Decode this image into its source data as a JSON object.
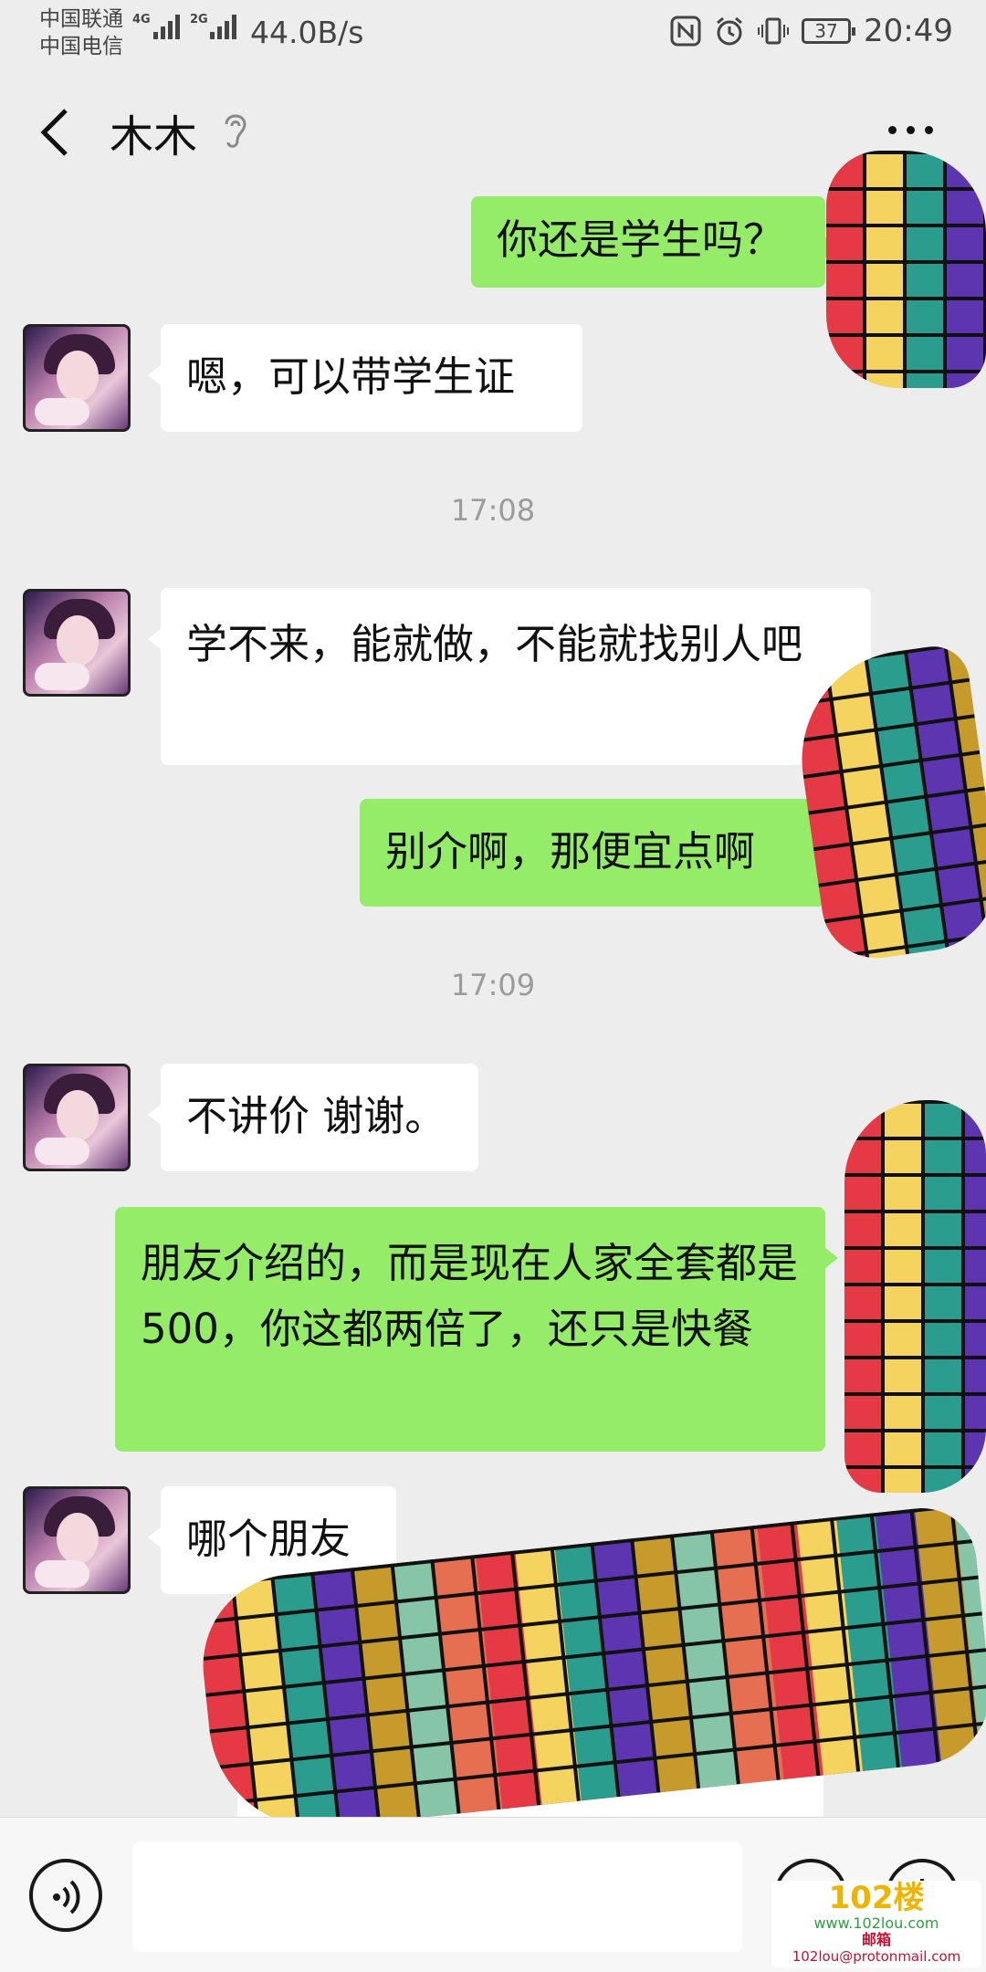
{
  "status_bar": {
    "carrier_1": "中国联通",
    "carrier_2": "中国电信",
    "net_1": "4G",
    "net_2": "2G",
    "speed": "44.0B/s",
    "battery": "37",
    "time": "20:49"
  },
  "nav": {
    "title": "木木"
  },
  "messages": [
    {
      "side": "out",
      "text": "你还是学生吗？"
    },
    {
      "side": "in",
      "text": "嗯，可以带学生证"
    },
    {
      "type": "time",
      "text": "17:08"
    },
    {
      "side": "in",
      "text": "学不来，能就做，不能就找别人吧"
    },
    {
      "side": "out",
      "text": "别介啊，那便宜点啊"
    },
    {
      "type": "time",
      "text": "17:09"
    },
    {
      "side": "in",
      "text": "不讲价 谢谢。"
    },
    {
      "side": "out",
      "text": "朋友介绍的，而是现在人家全套都是 500，你这都两倍了，还只是快餐"
    },
    {
      "side": "in",
      "text": "哪个朋友"
    }
  ],
  "input_bar": {
    "placeholder": ""
  },
  "watermark": {
    "logo": "102楼",
    "site": "www.102lou.com",
    "mailbox": "邮箱",
    "email": "102lou@protonmail.com"
  },
  "colors": {
    "background": "#ededed",
    "bubble_out": "#95ec69",
    "bubble_in": "#ffffff"
  }
}
